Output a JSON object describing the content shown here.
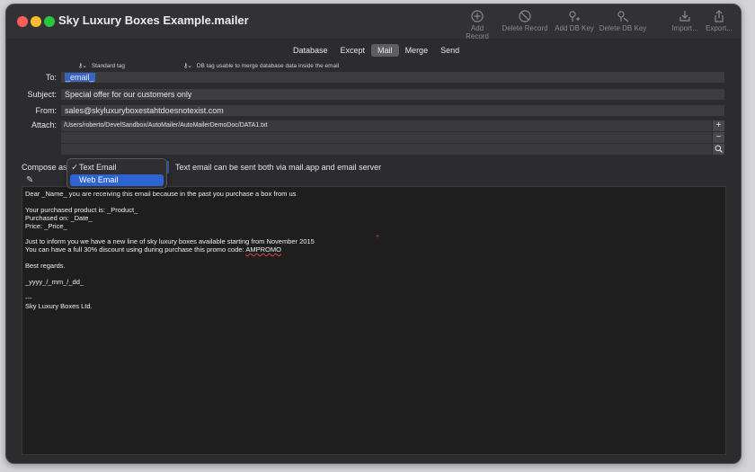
{
  "window": {
    "title": "Sky Luxury Boxes Example.mailer"
  },
  "toolbar": {
    "add_record": "Add Record",
    "delete_record": "Delete Record",
    "add_db_key": "Add DB Key",
    "delete_db_key": "Delete DB Key",
    "import": "Import...",
    "export": "Export..."
  },
  "tabs": [
    "Database",
    "Except",
    "Mail",
    "Merge",
    "Send"
  ],
  "active_tab": "Mail",
  "legend": {
    "standard_tag": "Standard tag",
    "db_tag": "DB tag usable to merge database data inside the email"
  },
  "form": {
    "to_label": "To:",
    "to_value": "_email_",
    "subject_label": "Subject:",
    "subject_value": "Special offer for our customers only",
    "from_label": "From:",
    "from_value": "sales@skyluxuryboxestahtdoesnotexist.com",
    "attach_label": "Attach:",
    "attachments": [
      "/Users/roberto/DevelSandbox/AutoMailer/AutoMailerDemoDoc/DATA1.txt"
    ]
  },
  "compose": {
    "label": "Compose as",
    "note": "Text email can be sent both via mail.app and email server",
    "options": [
      {
        "label": "Text Email",
        "checked": true,
        "highlighted": false
      },
      {
        "label": "Web Email",
        "checked": false,
        "highlighted": true
      }
    ]
  },
  "body": {
    "greeting": "Dear _Name_ you are receiving this email because in the past you purchase a box from us",
    "product": "Your purchased product is: _Product_",
    "date": "Purchased on: _Date_",
    "price": "Price: _Price_",
    "line_offer": "Just to inform you we have a new line of sky luxury boxes available starting from November 2015",
    "line_discount": "You can have a full 30% discount using during purchase this promo code: ",
    "promo_code": "AMPROMO",
    "regards": "Best regards.",
    "date_tag": "_yyyy_/_mm_/_dd_",
    "separator": "---",
    "signature": "Sky Luxury Boxes Ltd."
  },
  "colors": {
    "accent": "#2e63d3",
    "selection": "#3a64c4",
    "window_bg": "#2c2c2e",
    "editor_bg": "#1e1e1e"
  },
  "icons": {
    "add_record": "plus-circle-icon",
    "delete_record": "prohibit-icon",
    "add_db_key": "key-plus-icon",
    "delete_db_key": "key-minus-icon",
    "import": "import-icon",
    "export": "share-icon",
    "pencil": "pencil-icon",
    "search": "search-icon"
  }
}
